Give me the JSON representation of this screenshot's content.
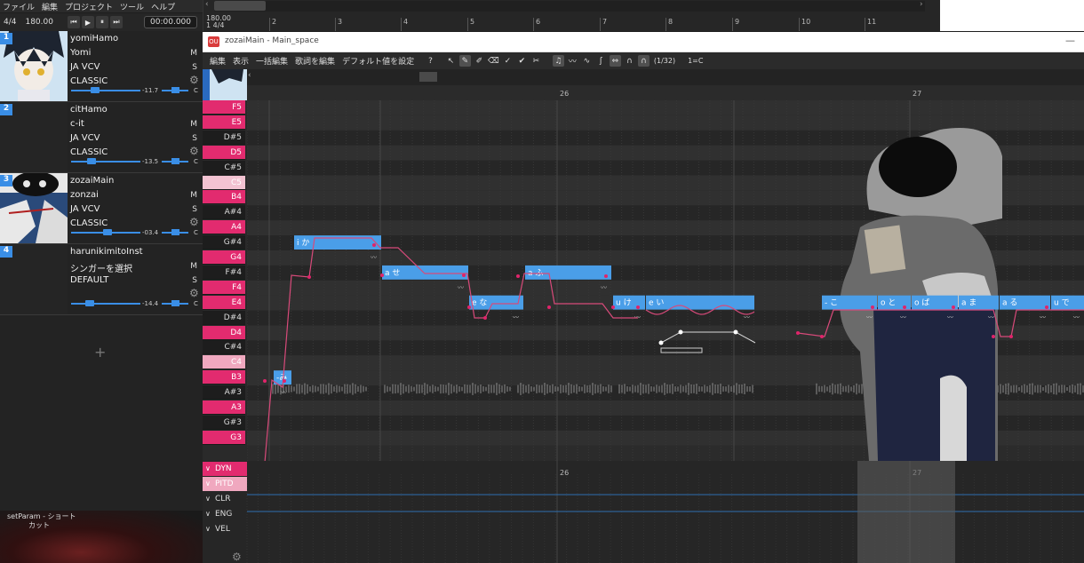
{
  "main_menu": [
    "ファイル",
    "編集",
    "プロジェクト",
    "ツール",
    "ヘルプ"
  ],
  "transport": {
    "signature": "4/4",
    "bpm": "180.00",
    "time": "00:00.000"
  },
  "timeline": {
    "tempo_value": "180.00",
    "tempo_sig": "1 4/4",
    "bars": [
      "2",
      "3",
      "4",
      "5",
      "6",
      "7",
      "8",
      "9",
      "10",
      "11"
    ]
  },
  "tracks": [
    {
      "number": "1",
      "name": "yomiHamo",
      "singer": "Yomi",
      "phonemizer": "JA VCV",
      "renderer": "CLASSIC",
      "volume": "-11.7",
      "pan": "C",
      "mute": "M",
      "solo": "S"
    },
    {
      "number": "2",
      "name": "citHamo",
      "singer": "c-it",
      "phonemizer": "JA VCV",
      "renderer": "CLASSIC",
      "volume": "-13.5",
      "pan": "C",
      "mute": "M",
      "solo": "S"
    },
    {
      "number": "3",
      "name": "zozaiMain",
      "singer": "zonzai",
      "phonemizer": "JA VCV",
      "renderer": "CLASSIC",
      "volume": "-03.4",
      "pan": "C",
      "mute": "M",
      "solo": "S"
    },
    {
      "number": "4",
      "name": "harunikimitoInst",
      "singer": "シンガーを選択",
      "phonemizer": "DEFAULT",
      "renderer": "",
      "volume": "-14.4",
      "pan": "C",
      "mute": "M",
      "solo": "S"
    }
  ],
  "add_track": "+",
  "bottom_left_text": [
    "setParam - ショート",
    "カット"
  ],
  "piano_roll": {
    "title": "zozaiMain - Main_space",
    "menu": [
      "編集",
      "表示",
      "一括編集",
      "歌詞を編集",
      "デフォルト値を設定",
      "?"
    ],
    "snap": "(1/32)",
    "key": "1=C",
    "bars": [
      "26",
      "27"
    ],
    "keys": [
      "F5",
      "E5",
      "D#5",
      "D5",
      "C#5",
      "C5",
      "B4",
      "A#4",
      "A4",
      "G#4",
      "G4",
      "F#4",
      "F4",
      "E4",
      "D#4",
      "D4",
      "C#4",
      "C4",
      "B3",
      "A#3",
      "A3",
      "G#3",
      "G3"
    ],
    "notes": [
      {
        "lyric": "-み",
        "pitch": "B3"
      },
      {
        "lyric": "i か",
        "pitch": "G#4"
      },
      {
        "lyric": "a せ",
        "pitch": "F#4"
      },
      {
        "lyric": "e な",
        "pitch": "E4"
      },
      {
        "lyric": "a ふ",
        "pitch": "F#4"
      },
      {
        "lyric": "u け",
        "pitch": "E4"
      },
      {
        "lyric": "e い",
        "pitch": "E4"
      },
      {
        "lyric": "- こ",
        "pitch": "E4"
      },
      {
        "lyric": "o と",
        "pitch": "E4"
      },
      {
        "lyric": "o ば",
        "pitch": "E4"
      },
      {
        "lyric": "a ま",
        "pitch": "E4"
      },
      {
        "lyric": "a る",
        "pitch": "E4"
      },
      {
        "lyric": "u で",
        "pitch": "E4"
      }
    ],
    "expressions": [
      "DYN",
      "PITD",
      "CLR",
      "ENG",
      "VEL"
    ]
  },
  "colors": {
    "accent_blue": "#3a8ee6",
    "note_blue": "#4a9ee8",
    "key_pink": "#e22b6f",
    "pitch_red": "#d84a7a"
  }
}
